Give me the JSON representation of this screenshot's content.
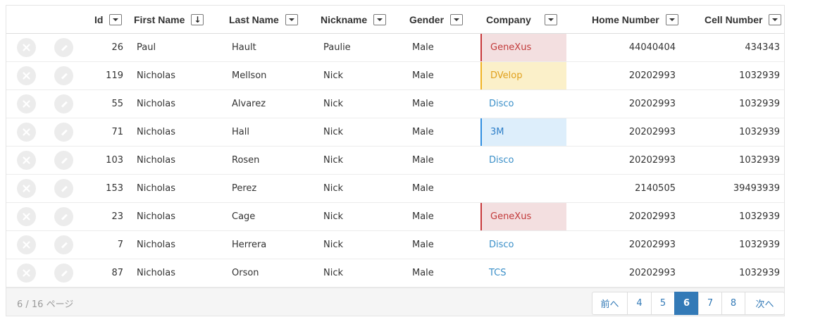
{
  "columns": [
    {
      "label": "Id",
      "sort": "none"
    },
    {
      "label": "First Name",
      "sort": "descending"
    },
    {
      "label": "Last Name",
      "sort": "none"
    },
    {
      "label": "Nickname",
      "sort": "none"
    },
    {
      "label": "Gender",
      "sort": "none"
    },
    {
      "label": "Company",
      "sort": "none"
    },
    {
      "label": "Home Number",
      "sort": "none"
    },
    {
      "label": "Cell Number",
      "sort": "none"
    }
  ],
  "rows": [
    {
      "id": "26",
      "first": "Paul",
      "last": "Hault",
      "nick": "Paulie",
      "gender": "Male",
      "company": "GeneXus",
      "company_style": "genexus",
      "home": "44040404",
      "cell": "434343"
    },
    {
      "id": "119",
      "first": "Nicholas",
      "last": "Mellson",
      "nick": "Nick",
      "gender": "Male",
      "company": "DVelop",
      "company_style": "dvelop",
      "home": "20202993",
      "cell": "1032939"
    },
    {
      "id": "55",
      "first": "Nicholas",
      "last": "Alvarez",
      "nick": "Nick",
      "gender": "Male",
      "company": "Disco",
      "company_style": "plain",
      "home": "20202993",
      "cell": "1032939"
    },
    {
      "id": "71",
      "first": "Nicholas",
      "last": "Hall",
      "nick": "Nick",
      "gender": "Male",
      "company": "3M",
      "company_style": "3m",
      "home": "20202993",
      "cell": "1032939"
    },
    {
      "id": "103",
      "first": "Nicholas",
      "last": "Rosen",
      "nick": "Nick",
      "gender": "Male",
      "company": "Disco",
      "company_style": "plain",
      "home": "20202993",
      "cell": "1032939"
    },
    {
      "id": "153",
      "first": "Nicholas",
      "last": "Perez",
      "nick": "Nick",
      "gender": "Male",
      "company": "",
      "company_style": "plain",
      "home": "2140505",
      "cell": "39493939"
    },
    {
      "id": "23",
      "first": "Nicholas",
      "last": "Cage",
      "nick": "Nick",
      "gender": "Male",
      "company": "GeneXus",
      "company_style": "genexus",
      "home": "20202993",
      "cell": "1032939"
    },
    {
      "id": "7",
      "first": "Nicholas",
      "last": "Herrera",
      "nick": "Nick",
      "gender": "Male",
      "company": "Disco",
      "company_style": "plain",
      "home": "20202993",
      "cell": "1032939"
    },
    {
      "id": "87",
      "first": "Nicholas",
      "last": "Orson",
      "nick": "Nick",
      "gender": "Male",
      "company": "TCS",
      "company_style": "plain",
      "home": "20202993",
      "cell": "1032939"
    }
  ],
  "row_icons": {
    "delete": "close-icon",
    "edit": "eraser-icon"
  },
  "footer": {
    "page_info": "6 / 16  ページ"
  },
  "pager": {
    "prev": "前へ",
    "pages": [
      "4",
      "5",
      "6",
      "7",
      "8"
    ],
    "active": "6",
    "next": "次へ"
  },
  "colors": {
    "genexus": "#c23a3a",
    "dvelop": "#e0a01c",
    "threem": "#2f7fc8",
    "link": "#3a8fc8",
    "pager_active": "#337ab7"
  }
}
